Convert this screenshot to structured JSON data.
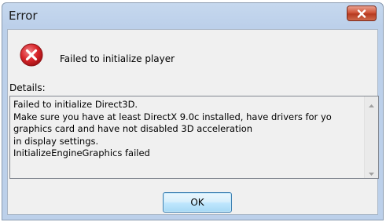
{
  "window": {
    "title": "Error",
    "close_icon": "close-icon"
  },
  "message": {
    "icon": "error-icon",
    "text": "Failed to initialize player"
  },
  "details": {
    "label": "Details:",
    "text": "Failed to initialize Direct3D.\nMake sure you have at least DirectX 9.0c installed, have drivers for yo\ngraphics card and have not disabled 3D acceleration\nin display settings.\nInitializeEngineGraphics failed"
  },
  "buttons": {
    "ok_label": "OK"
  },
  "colors": {
    "error_red": "#d9252a",
    "close_button_red": "#c7442a",
    "dialog_background": "#f0f0f0",
    "button_border": "#3c7fb1"
  }
}
